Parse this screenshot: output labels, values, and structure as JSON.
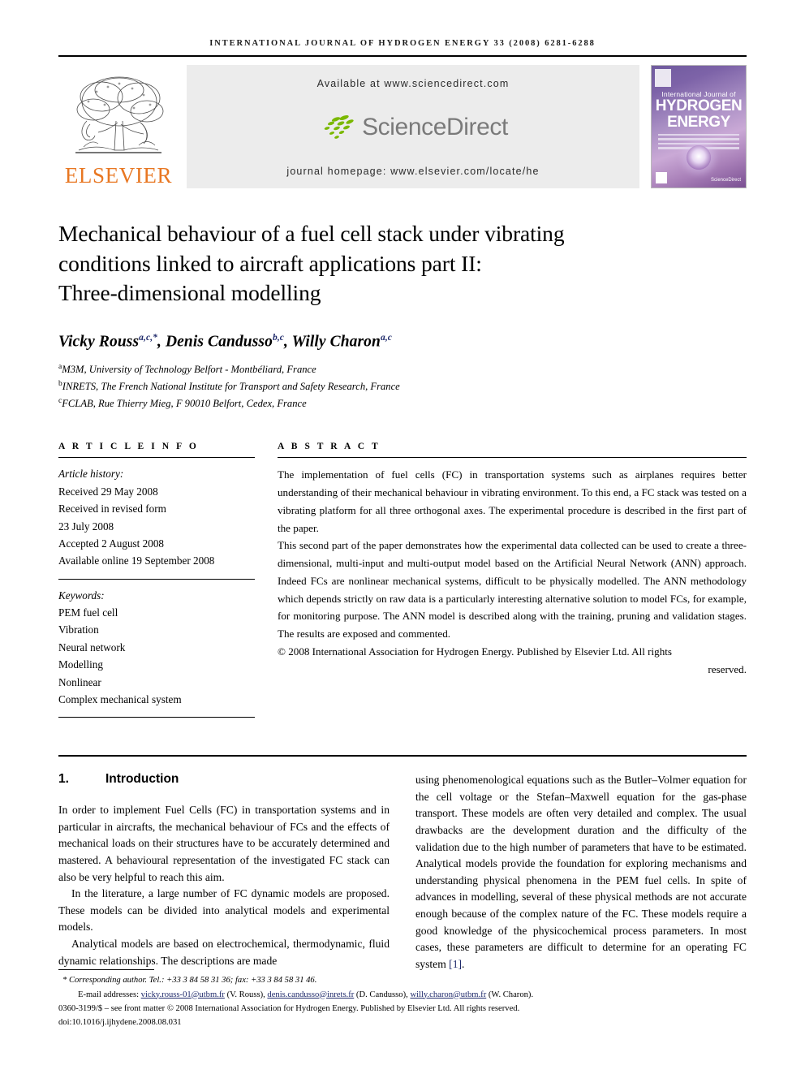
{
  "running_head": "INTERNATIONAL JOURNAL OF HYDROGEN ENERGY 33 (2008) 6281-6288",
  "masthead": {
    "publisher_name": "ELSEVIER",
    "available_at": "Available at www.sciencedirect.com",
    "sciencedirect_wordmark": "ScienceDirect",
    "journal_homepage": "journal homepage: www.elsevier.com/locate/he",
    "cover": {
      "line1": "International Journal of",
      "line2": "HYDROGEN",
      "line3": "ENERGY",
      "imprint": "ScienceDirect"
    }
  },
  "article": {
    "title_line1": "Mechanical behaviour of a fuel cell stack under vibrating",
    "title_line2": "conditions linked to aircraft applications part II:",
    "title_line3": "Three-dimensional modelling",
    "authors_html": "Vicky Rouss<sup>a,c,*</sup>, Denis Candusso<sup>b,c</sup>, Willy Charon<sup>a,c</sup>",
    "affiliations": [
      {
        "marker": "a",
        "text": "M3M, University of Technology Belfort - Montbéliard, France"
      },
      {
        "marker": "b",
        "text": "INRETS, The French National Institute for Transport and Safety Research, France"
      },
      {
        "marker": "c",
        "text": "FCLAB, Rue Thierry Mieg, F 90010 Belfort, Cedex, France"
      }
    ]
  },
  "article_info": {
    "label": "A R T I C L E  I N F O",
    "history_label": "Article history:",
    "history": [
      "Received 29 May 2008",
      "Received in revised form",
      "23 July 2008",
      "Accepted 2 August 2008",
      "Available online 19 September 2008"
    ],
    "keywords_label": "Keywords:",
    "keywords": [
      "PEM fuel cell",
      "Vibration",
      "Neural network",
      "Modelling",
      "Nonlinear",
      "Complex mechanical system"
    ]
  },
  "abstract": {
    "label": "A B S T R A C T",
    "paragraph1": "The implementation of fuel cells (FC) in transportation systems such as airplanes requires better understanding of their mechanical behaviour in vibrating environment. To this end, a FC stack was tested on a vibrating platform for all three orthogonal axes. The experimental procedure is described in the first part of the paper.",
    "paragraph2": "This second part of the paper demonstrates how the experimental data collected can be used to create a three-dimensional, multi-input and multi-output model based on the Artificial Neural Network (ANN) approach. Indeed FCs are nonlinear mechanical systems, difficult to be physically modelled. The ANN methodology which depends strictly on raw data is a particularly interesting alternative solution to model FCs, for example, for monitoring purpose. The ANN model is described along with the training, pruning and validation stages. The results are exposed and commented.",
    "copyright_main": "© 2008 International Association for Hydrogen Energy. Published by Elsevier Ltd. All rights",
    "copyright_tail": "reserved."
  },
  "introduction": {
    "number": "1.",
    "heading": "Introduction",
    "left_paragraphs": [
      "In order to implement Fuel Cells (FC) in transportation systems and in particular in aircrafts, the mechanical behaviour of FCs and the effects of mechanical loads on their structures have to be accurately determined and mastered. A behavioural representation of the investigated FC stack can also be very helpful to reach this aim.",
      "In the literature, a large number of FC dynamic models are proposed. These models can be divided into analytical models and experimental models.",
      "Analytical models are based on electrochemical, thermodynamic, fluid dynamic relationships. The descriptions are made"
    ],
    "right_paragraph_pre": "using phenomenological equations such as the Butler–Volmer equation for the cell voltage or the Stefan–Maxwell equation for the gas-phase transport. These models are often very detailed and complex. The usual drawbacks are the development duration and the difficulty of the validation due to the high number of parameters that have to be estimated. Analytical models provide the foundation for exploring mechanisms and understanding physical phenomena in the PEM fuel cells. In spite of advances in modelling, several of these physical methods are not accurate enough because of the complex nature of the FC. These models require a good knowledge of the physicochemical process parameters. In most cases, these parameters are difficult to determine for an operating FC system ",
    "right_reference": "[1]",
    "right_paragraph_post": "."
  },
  "footer": {
    "corresponding": "* Corresponding author. Tel.: +33 3 84 58 31 36; fax: +33 3 84 58 31 46.",
    "email_label": "E-mail addresses:",
    "emails": [
      {
        "address": "vicky.rouss-01@utbm.fr",
        "person": "(V. Rouss),"
      },
      {
        "address": "denis.candusso@inrets.fr",
        "person": "(D. Candusso),"
      },
      {
        "address": "willy.charon@utbm.fr",
        "person": "(W. Charon)."
      }
    ],
    "front_matter": "0360-3199/$ – see front matter © 2008 International Association for Hydrogen Energy. Published by Elsevier Ltd. All rights reserved.",
    "doi": "doi:10.1016/j.ijhydene.2008.08.031"
  },
  "colors": {
    "elsevier_orange": "#E87722",
    "sciencedirect_green": "#7AB800",
    "sciencedirect_gray": "#7A7A7A",
    "link_navy": "#1F2A6B",
    "band_gray": "#ECECEC"
  }
}
